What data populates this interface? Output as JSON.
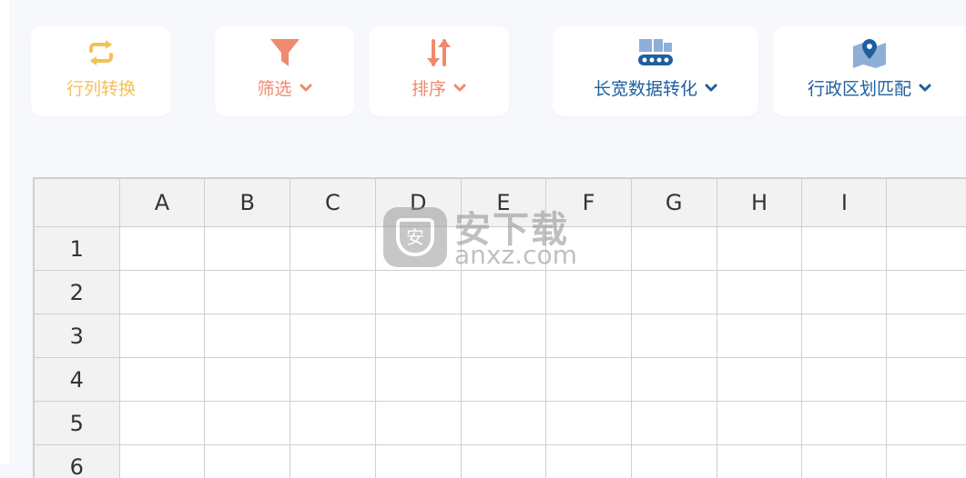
{
  "toolbar": {
    "transpose": {
      "label": "行列转换",
      "color": "#f2c25a",
      "icon": "transpose-arrows-icon"
    },
    "filter": {
      "label": "筛选",
      "color": "#f08a6e",
      "icon": "funnel-icon"
    },
    "sort": {
      "label": "排序",
      "color": "#f08a6e",
      "icon": "sort-arrows-icon"
    },
    "reshape": {
      "label": "长宽数据转化",
      "color": "#1f5f9e",
      "icon": "conveyor-icon"
    },
    "region": {
      "label": "行政区划匹配",
      "color": "#1f5f9e",
      "icon": "map-pin-icon"
    }
  },
  "grid": {
    "columns": [
      "A",
      "B",
      "C",
      "D",
      "E",
      "F",
      "G",
      "H",
      "I",
      ""
    ],
    "rows": [
      "1",
      "2",
      "3",
      "4",
      "5",
      "6"
    ]
  },
  "watermark": {
    "cn": "安下载",
    "en": "anxz.com",
    "shield_char": "安"
  }
}
